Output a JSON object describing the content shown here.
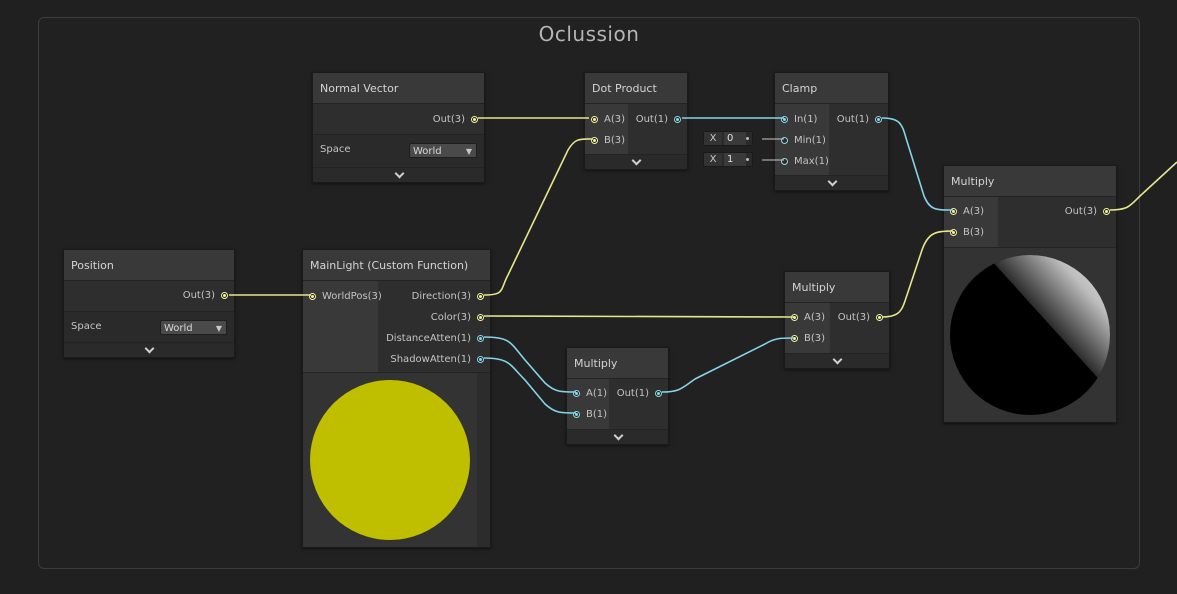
{
  "group": {
    "title": "Oclussion"
  },
  "nodes": {
    "position": {
      "title": "Position",
      "out": "Out(3)",
      "space_label": "Space",
      "space_value": "World"
    },
    "normal_vector": {
      "title": "Normal Vector",
      "out": "Out(3)",
      "space_label": "Space",
      "space_value": "World"
    },
    "main_light": {
      "title": "MainLight (Custom Function)",
      "in": "WorldPos(3)",
      "outs": [
        "Direction(3)",
        "Color(3)",
        "DistanceAtten(1)",
        "ShadowAtten(1)"
      ]
    },
    "dot_product": {
      "title": "Dot Product",
      "ins": [
        "A(3)",
        "B(3)"
      ],
      "out": "Out(1)"
    },
    "clamp": {
      "title": "Clamp",
      "ins": [
        "In(1)",
        "Min(1)",
        "Max(1)"
      ],
      "out": "Out(1)",
      "min_axis": "X",
      "min_value": "0",
      "max_axis": "X",
      "max_value": "1"
    },
    "multiply_atten": {
      "title": "Multiply",
      "ins": [
        "A(1)",
        "B(1)"
      ],
      "out": "Out(1)"
    },
    "multiply_color": {
      "title": "Multiply",
      "ins": [
        "A(3)",
        "B(3)"
      ],
      "out": "Out(3)"
    },
    "multiply_final": {
      "title": "Multiply",
      "ins": [
        "A(3)",
        "B(3)"
      ],
      "out": "Out(3)"
    }
  },
  "colors": {
    "vector3_wire": "#e6e68c",
    "float_wire": "#84d4e6",
    "light_color_preview": "#bfbf00"
  }
}
